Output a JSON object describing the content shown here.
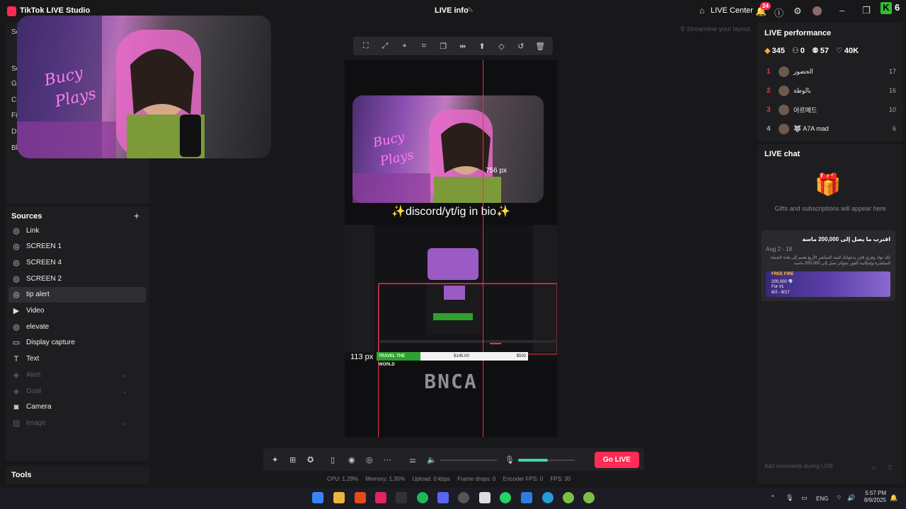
{
  "titlebar": {
    "app_title": "TikTok LIVE Studio",
    "live_info": "LIVE info",
    "live_center": "LIVE Center",
    "notif_count": "24",
    "k_value": "6"
  },
  "left": {
    "cut_labels": [
      "Sc",
      "Sc",
      "Ge",
      "Ch",
      "Fil",
      "Du",
      "Bla"
    ]
  },
  "sources": {
    "title": "Sources",
    "items": [
      {
        "label": "Link",
        "icon": "globe-icon",
        "glyph": "◎",
        "active": false,
        "dim": false
      },
      {
        "label": "SCREEN 1",
        "icon": "globe-icon",
        "glyph": "◎",
        "active": false,
        "dim": false
      },
      {
        "label": "SCREEN 4",
        "icon": "globe-icon",
        "glyph": "◎",
        "active": false,
        "dim": false
      },
      {
        "label": "SCREEN 2",
        "icon": "globe-icon",
        "glyph": "◎",
        "active": false,
        "dim": false
      },
      {
        "label": "tip alert",
        "icon": "globe-icon",
        "glyph": "◎",
        "active": true,
        "dim": false
      },
      {
        "label": "Video",
        "icon": "play-icon",
        "glyph": "▶",
        "active": false,
        "dim": false
      },
      {
        "label": "elevate",
        "icon": "globe-icon",
        "glyph": "◎",
        "active": false,
        "dim": false
      },
      {
        "label": "Display capture",
        "icon": "monitor-icon",
        "glyph": "▭",
        "active": false,
        "dim": false
      },
      {
        "label": "Text",
        "icon": "text-icon",
        "glyph": "T",
        "active": false,
        "dim": false
      },
      {
        "label": "Alert",
        "icon": "alert-icon",
        "glyph": "◈",
        "active": false,
        "dim": true
      },
      {
        "label": "Goal",
        "icon": "goal-icon",
        "glyph": "◈",
        "active": false,
        "dim": true
      },
      {
        "label": "Camera",
        "icon": "camera-icon",
        "glyph": "◙",
        "active": false,
        "dim": false
      },
      {
        "label": "Image",
        "icon": "image-icon",
        "glyph": "▨",
        "active": false,
        "dim": true
      }
    ]
  },
  "tools": {
    "title": "Tools"
  },
  "canvas": {
    "streamline_tip": "Streamline your layout",
    "bio_text": "✨discord/yt/ig in bio✨",
    "px_label_top": "756 px",
    "px_label_left": "113 px",
    "goal_left": "TRAVEL THE WORLD",
    "goal_amount": "$145.00",
    "goal_target": "$500",
    "bnca": "BNCA"
  },
  "bottom": {
    "go_live": "Go LIVE",
    "stats": {
      "cpu": "CPU: 1.29%",
      "memory": "Memory: 1.35%",
      "upload": "Upload: 0 kbps",
      "frame_drops": "Frame drops: 0",
      "encoder_fps": "Encoder FPS: 0",
      "fps": "FPS: 30"
    },
    "mic_level": 0.52
  },
  "performance": {
    "title": "LIVE performance",
    "diamonds": "345",
    "viewers": "0",
    "new_followers": "57",
    "likes": "40K",
    "ranking": [
      {
        "rank": "1",
        "name": "الحضور",
        "score": "17"
      },
      {
        "rank": "2",
        "name": "بالوطة",
        "score": "16"
      },
      {
        "rank": "3",
        "name": "아르메드",
        "score": "10"
      },
      {
        "rank": "4",
        "name": "🐺 A7A mad",
        "score": "6"
      }
    ]
  },
  "chat": {
    "title": "LIVE chat",
    "empty_text": "Gifts and subscriptions will appear here",
    "promo_title": "اقترب ما يصل إلى 200,000 ماسة",
    "promo_date": "Aug 2 - 18",
    "promo_desc": "ثبّك توك وفري فاير يدعوانك للبث المباشر الأربع تعمم إلى هذه الحملة المباشرة وإمكانية الفوز بجوائز تصل إلى 200,000 ماسة",
    "banner_brand": "FREE FIRE",
    "banner_amount": "200,000 💎",
    "banner_for": "For #1",
    "banner_dates": "8/2 - 8/17",
    "input_placeholder": "Add comments during LIVE"
  },
  "taskbar": {
    "lang": "ENG",
    "time": "5:57 PM",
    "date": "8/9/2025"
  },
  "colors": {
    "accent": "#fe2c55",
    "guide": "#e3364f",
    "mic_level": "#3ed9a5",
    "goal_green": "#2fa12f"
  }
}
